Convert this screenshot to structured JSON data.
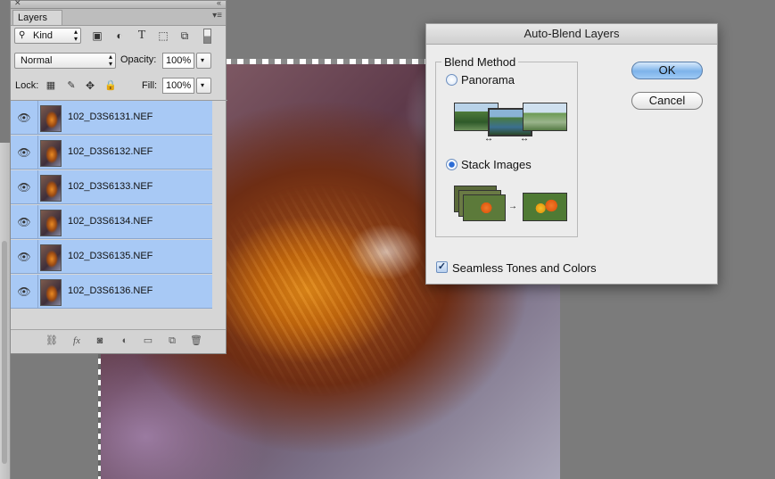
{
  "layers_panel": {
    "tab_label": "Layers",
    "filter": {
      "kind_label": "Kind",
      "icons": [
        "image-filter-icon",
        "adjustment-filter-icon",
        "type-filter-icon",
        "shape-filter-icon",
        "smart-object-filter-icon"
      ]
    },
    "blend_mode": "Normal",
    "opacity_label": "Opacity:",
    "opacity_value": "100%",
    "lock_label": "Lock:",
    "fill_label": "Fill:",
    "fill_value": "100%",
    "layers": [
      {
        "name": "102_D3S6131.NEF"
      },
      {
        "name": "102_D3S6132.NEF"
      },
      {
        "name": "102_D3S6133.NEF"
      },
      {
        "name": "102_D3S6134.NEF"
      },
      {
        "name": "102_D3S6135.NEF"
      },
      {
        "name": "102_D3S6136.NEF"
      }
    ],
    "footer_icons": [
      "link-layers-icon",
      "fx-icon",
      "add-mask-icon",
      "new-adjustment-icon",
      "new-group-icon",
      "new-layer-icon",
      "delete-layer-icon"
    ]
  },
  "dialog": {
    "title": "Auto-Blend Layers",
    "group_title": "Blend Method",
    "options": [
      {
        "label": "Panorama",
        "selected": false
      },
      {
        "label": "Stack Images",
        "selected": true
      }
    ],
    "seamless_label": "Seamless Tones and Colors",
    "seamless_checked": true,
    "ok_label": "OK",
    "cancel_label": "Cancel"
  },
  "colors": {
    "selection_blue": "#a8c9f5",
    "default_button": "#7db3ea"
  }
}
